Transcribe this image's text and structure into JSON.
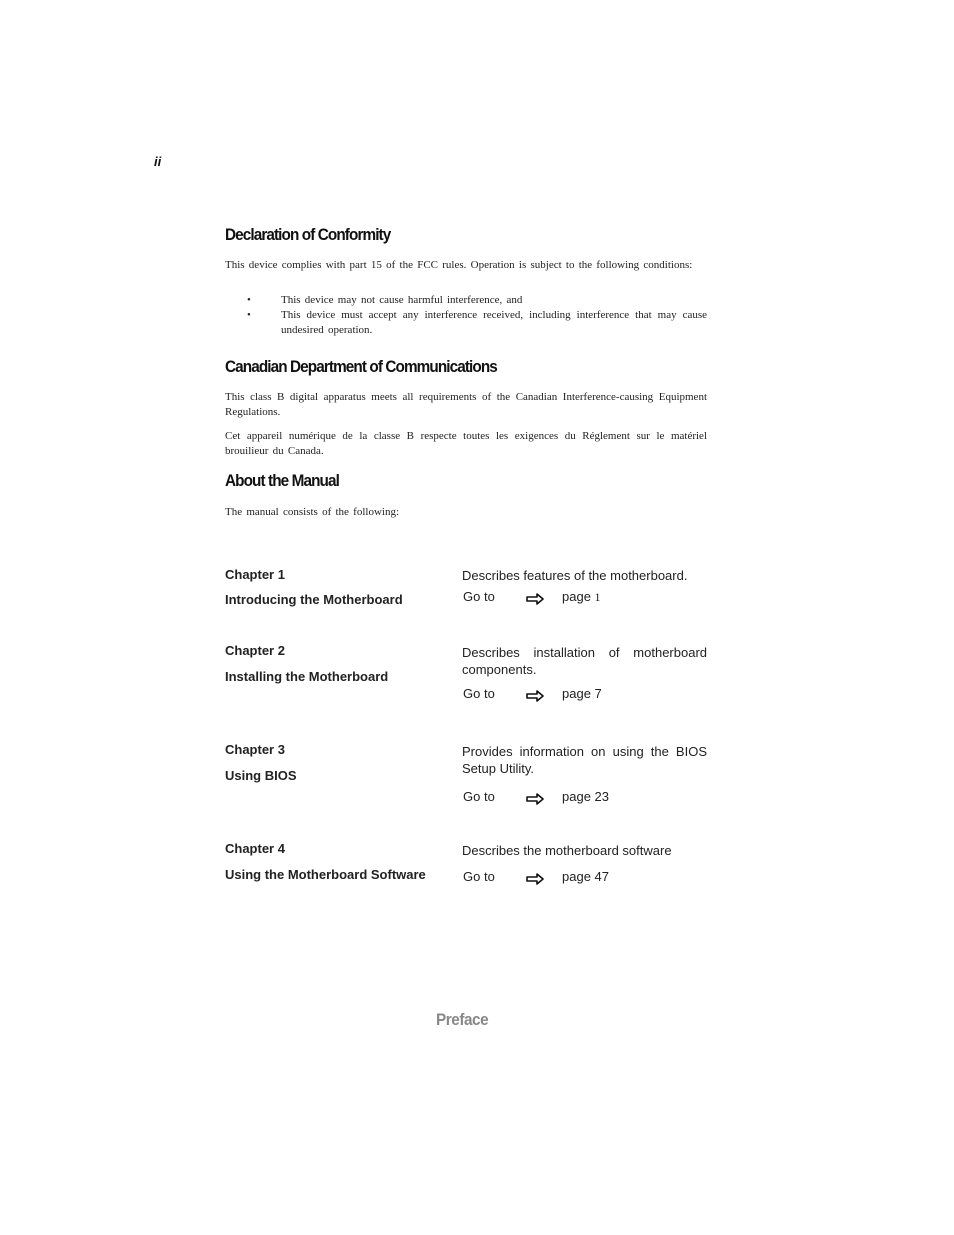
{
  "page_number": "ii",
  "sections": {
    "declaration": {
      "title": "Declaration of Conformity",
      "intro": "This device complies with part 15 of the FCC rules. Operation is subject to the following conditions:",
      "bullets": [
        "This device may not cause harmful interference, and",
        "This device must accept any interference received, including interference that may cause undesired operation."
      ],
      "bullet_symbol": "•"
    },
    "canadian": {
      "title": "Canadian Department of Communications",
      "paragraphs": [
        "This class B digital apparatus meets all requirements of the Canadian Interference-causing Equipment Regulations.",
        "Cet appareil numérique de la classe B respecte toutes les exigences du Réglement sur le matériel brouilieur du Canada."
      ]
    },
    "about": {
      "title": "About the Manual",
      "intro": "The manual consists of the following:"
    }
  },
  "chapters": [
    {
      "chapter": "Chapter 1",
      "title": "Introducing the Motherboard",
      "description": "Describes features of the motherboard.",
      "goto_label": "Go to",
      "arrow_icon": "right-arrow-icon",
      "page_label": "page",
      "page": "1"
    },
    {
      "chapter": "Chapter 2",
      "title": "Installing the Motherboard",
      "description": "Describes installation of motherboard components.",
      "goto_label": "Go to",
      "arrow_icon": "right-arrow-icon",
      "page_label": "page",
      "page": "7"
    },
    {
      "chapter": "Chapter 3",
      "title": "Using BIOS",
      "description": "Provides information on using the BIOS Setup Utility.",
      "goto_label": "Go to",
      "arrow_icon": "right-arrow-icon",
      "page_label": "page",
      "page": "23"
    },
    {
      "chapter": "Chapter 4",
      "title": "Using the Motherboard Software",
      "description": "Describes the motherboard software",
      "goto_label": "Go to",
      "arrow_icon": "right-arrow-icon",
      "page_label": "page",
      "page": "47"
    }
  ],
  "footer": "Preface",
  "colors": {
    "text": "#222222",
    "footer": "#888888"
  }
}
